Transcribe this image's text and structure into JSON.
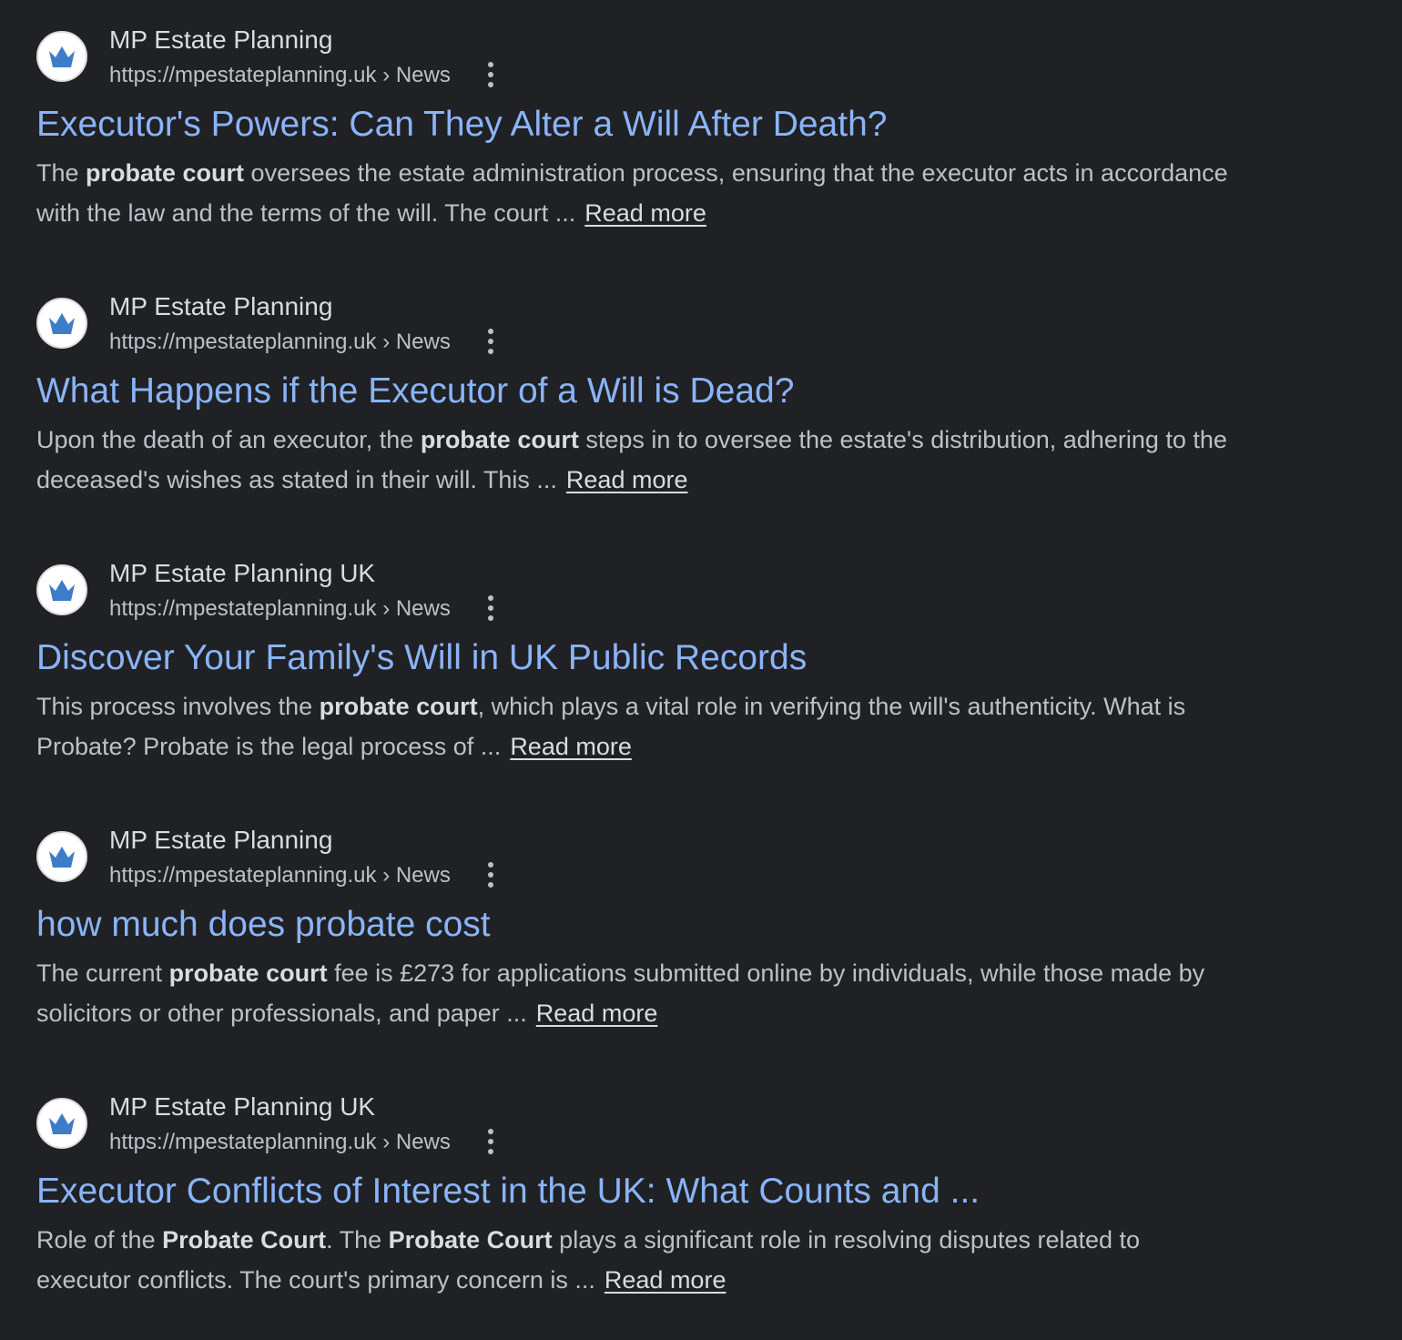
{
  "results": [
    {
      "site_name": "MP Estate Planning",
      "url": "https://mpestateplanning.uk › News",
      "title": "Executor's Powers: Can They Alter a Will After Death?",
      "snippet_parts": [
        "The ",
        "probate court",
        " oversees the estate administration process, ensuring that the executor acts in accordance with the law and the terms of the will. The court ...",
        "",
        ""
      ],
      "read_more": "Read more"
    },
    {
      "site_name": "MP Estate Planning",
      "url": "https://mpestateplanning.uk › News",
      "title": "What Happens if the Executor of a Will is Dead?",
      "snippet_parts": [
        "Upon the death of an executor, the ",
        "probate court",
        " steps in to oversee the estate's distribution, adhering to the deceased's wishes as stated in their will. This ...",
        "",
        ""
      ],
      "read_more": "Read more"
    },
    {
      "site_name": "MP Estate Planning UK",
      "url": "https://mpestateplanning.uk › News",
      "title": "Discover Your Family's Will in UK Public Records",
      "snippet_parts": [
        "This process involves the ",
        "probate court",
        ", which plays a vital role in verifying the will's authenticity. What is Probate? Probate is the legal process of ...",
        "",
        ""
      ],
      "read_more": "Read more"
    },
    {
      "site_name": "MP Estate Planning",
      "url": "https://mpestateplanning.uk › News",
      "title": "how much does probate cost",
      "snippet_parts": [
        "The current ",
        "probate court",
        " fee is £273 for applications submitted online by individuals, while those made by solicitors or other professionals, and paper ...",
        "",
        ""
      ],
      "read_more": "Read more"
    },
    {
      "site_name": "MP Estate Planning UK",
      "url": "https://mpestateplanning.uk › News",
      "title": "Executor Conflicts of Interest in the UK: What Counts and ...",
      "snippet_parts": [
        "Role of the ",
        "Probate Court",
        ". The ",
        "Probate Court",
        " plays a significant role in resolving disputes related to executor conflicts. The court's primary concern is ..."
      ],
      "read_more": "Read more"
    }
  ],
  "icons": {
    "favicon": "crown-icon",
    "more": "more-vertical-icon"
  },
  "colors": {
    "background": "#202124",
    "title_link": "#8ab4f8",
    "favicon_crown": "#3d7cc9"
  }
}
